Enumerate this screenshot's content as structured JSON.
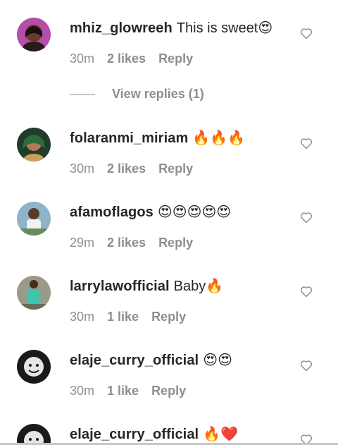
{
  "comments": [
    {
      "username": "mhiz_glowreeh",
      "text": "This is sweet😍",
      "time": "30m",
      "likes": "2 likes",
      "reply": "Reply",
      "view_replies": "View replies (1)"
    },
    {
      "username": "folaranmi_miriam",
      "text": "🔥🔥🔥",
      "time": "30m",
      "likes": "2 likes",
      "reply": "Reply"
    },
    {
      "username": "afamoflagos",
      "text": "😍😍😍😍😍",
      "time": "29m",
      "likes": "2 likes",
      "reply": "Reply"
    },
    {
      "username": "larrylawofficial",
      "text": "Baby🔥",
      "time": "30m",
      "likes": "1 like",
      "reply": "Reply"
    },
    {
      "username": "elaje_curry_official",
      "text": "😍😍",
      "time": "30m",
      "likes": "1 like",
      "reply": "Reply"
    },
    {
      "username": "elaje_curry_official",
      "text": "🔥❤️"
    }
  ],
  "icons": {
    "like": "heart-outline-icon"
  },
  "colors": {
    "primary_text": "#262626",
    "secondary_text": "#8e8e8e"
  }
}
